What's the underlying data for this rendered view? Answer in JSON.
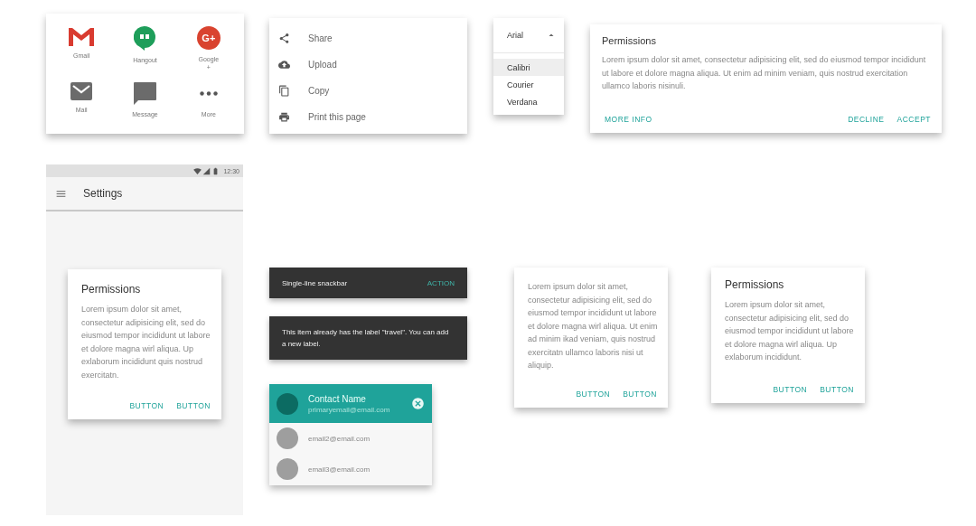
{
  "share_grid": {
    "items": [
      {
        "kind": "gmail",
        "label": "Gmail"
      },
      {
        "kind": "hangout",
        "label": "Hangout"
      },
      {
        "kind": "gplus",
        "label": "Google\n+",
        "logo_text": "G+"
      },
      {
        "kind": "mail",
        "label": "Mail"
      },
      {
        "kind": "message",
        "label": "Message"
      },
      {
        "kind": "more",
        "label": "More"
      }
    ]
  },
  "share_menu": {
    "items": [
      {
        "kind": "share",
        "label": "Share"
      },
      {
        "kind": "upload",
        "label": "Upload"
      },
      {
        "kind": "copy",
        "label": "Copy"
      },
      {
        "kind": "print",
        "label": "Print this page"
      }
    ]
  },
  "font_menu": {
    "current": "Arial",
    "expanded": true,
    "options": [
      {
        "label": "Calibri",
        "selected": true
      },
      {
        "label": "Courier",
        "selected": false
      },
      {
        "label": "Verdana",
        "selected": false
      }
    ]
  },
  "permissions_dialog": {
    "title": "Permissions",
    "body": "Lorem ipsum dolor sit amet, consectetur adipisicing elit, sed do eiusmod tempor incididunt ut labore et dolore magna aliqua. Ut enim ad minim veniam, quis nostrud exercitation ullamco laboris nisinuli.",
    "left_action": "MORE INFO",
    "actions": [
      "DECLINE",
      "ACCEPT"
    ]
  },
  "phone": {
    "status_time": "12:30",
    "title": "Settings",
    "dialog": {
      "title": "Permissions",
      "body": "Lorem ipsum dolor sit amet, consectetur adipisicing elit, sed do eiusmod tempor incididunt ut labore et dolore magna wirl aliqua. Up exlaborum incididunt quis nostrud exercitatn.",
      "actions": [
        "BUTTON",
        "BUTTON"
      ]
    }
  },
  "snackbars": [
    {
      "message": "Single-line snackbar",
      "action": "ACTION"
    },
    {
      "message": "This item already has the label \"travel\". You can add a new label."
    }
  ],
  "contact_chip": {
    "name": "Contact Name",
    "email": "primaryemail@email.com",
    "suggestions": [
      {
        "email": "email2@email.com"
      },
      {
        "email": "email3@email.com"
      }
    ]
  },
  "dialog_cards": [
    {
      "body": "Lorem ipsum dolor sit amet, consectetur adipisicing elit, sed do eiusmod tempor incididunt ut labore et dolore magna wirl aliqua. Ut enim ad minim ikad veniam, quis nostrud exercitatn ullamco laboris nisi ut aliquip.",
      "actions": [
        "BUTTON",
        "BUTTON"
      ]
    },
    {
      "title": "Permissions",
      "body": "Lorem ipsum dolor sit amet, consectetur adipisicing elit, sed do eiusmod tempor incididunt ut labore et dolore magna wirl aliqua. Up exlaborum incididunt.",
      "actions": [
        "BUTTON",
        "BUTTON"
      ]
    }
  ]
}
